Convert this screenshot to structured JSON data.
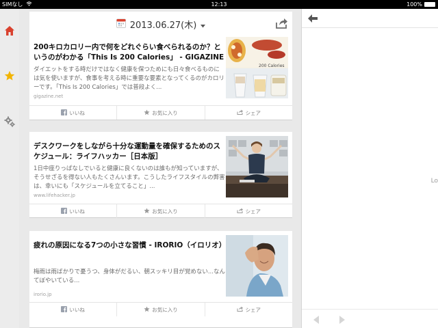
{
  "status_bar": {
    "carrier": "SIMなし",
    "time": "12:13",
    "battery": "100%",
    "battery_level": 1.0
  },
  "sidebar": {
    "items": [
      {
        "icon": "home-icon",
        "color": "#d9412e"
      },
      {
        "icon": "star-icon",
        "color": "#f2b400"
      },
      {
        "icon": "gear-icon",
        "color": "#8a8a8a"
      }
    ]
  },
  "header": {
    "date": "2013.06.27(木)",
    "calendar_icon": "calendar-icon",
    "share_icon": "share-icon"
  },
  "articles": [
    {
      "title": "200キロカロリー内で何をどれぐらい食べられるのか？というのがわかる「This Is 200 Calories」 - GIGAZINE",
      "excerpt": "ダイエットをする時だけではなく健康を保つためにも日々食べるものには気を使いますが、食事を考える時に重要な要素となってくるのがカロリーです。「This Is 200 Calories」では普段よく...",
      "source": "gigazine.net",
      "thumb_label": "200 Calories",
      "actions": {
        "like": "いいね",
        "favorite": "お気に入り",
        "share": "シェア"
      }
    },
    {
      "title": "デスクワークをしながら十分な運動量を確保するためのスケジュール：ライフハッカー［日本版］",
      "excerpt": "1日中座りっぱなしでいると健康に良くないのは誰もが知っていますが、そうせざるを得ない人もたくさんいます。こうしたライフスタイルの弊害は、幸いにも「スケジュールを立てること」...",
      "source": "www.lifehacker.jp",
      "thumb_label": "",
      "actions": {
        "like": "いいね",
        "favorite": "お気に入り",
        "share": "シェア"
      }
    },
    {
      "title": "疲れの原因になる7つの小さな習慣 - IRORIO（イロリオ）",
      "excerpt": "梅雨は雨ばかりで憂うつ、身体がだるい、朝スッキリ目が覚めない...なんてぼやいている...",
      "source": "irorio.jp",
      "thumb_label": "",
      "actions": {
        "like": "いいね",
        "favorite": "お気に入り",
        "share": "シェア"
      }
    }
  ],
  "right_pane": {
    "loading_text": "Lo",
    "back_icon": "back-arrow-icon",
    "prev_icon": "prev-arrow-icon",
    "next_icon": "next-arrow-icon"
  }
}
